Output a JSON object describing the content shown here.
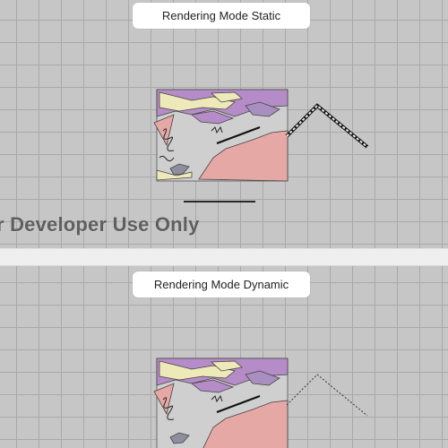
{
  "static_panel": {
    "label": "Rendering Mode Static"
  },
  "dynamic_panel": {
    "label": "Rendering Mode Dynamic"
  },
  "watermark": "r Developer Use Only",
  "colors": {
    "background": "#c6c6c6",
    "grid": "#a9a9a9",
    "divider": "#efefef",
    "purple": "#b58cc7",
    "pink": "#e6a8a4",
    "cream": "#eee9b9",
    "gray": "#cfcfcf"
  }
}
